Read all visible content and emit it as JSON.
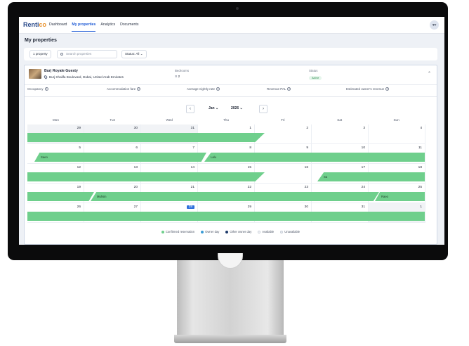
{
  "app": {
    "logo": "Renti",
    "logo_accent": "co"
  },
  "nav": {
    "items": [
      "Dashboard",
      "My properties",
      "Analytics",
      "Documents"
    ],
    "active": "My properties"
  },
  "user": {
    "initials": "TT"
  },
  "page": {
    "title": "My properties"
  },
  "toolbar": {
    "count_label": "1 property",
    "search_placeholder": "Search properties",
    "status_filter": "Status: All"
  },
  "property": {
    "name": "Burj Royale Guesty",
    "address": "Burj Khalifa Boulevard, Dubai, United Arab Emirates",
    "bedrooms_label": "Bedrooms",
    "bedrooms_value": "2",
    "status_label": "Status",
    "status_value": "Active"
  },
  "stats": {
    "occupancy": "Occupancy",
    "accommodation_fare": "Accommodation fare",
    "avg_nightly_rate": "Average nightly rate",
    "revenue_pal": "Revenue PAL",
    "owner_revenue": "Estimated owner's revenue"
  },
  "calendar": {
    "month": "Jan",
    "year": "2026",
    "day_names": [
      "Mon",
      "Tue",
      "Wed",
      "Thu",
      "Fri",
      "Sat",
      "Sun"
    ],
    "weeks": [
      [
        "29",
        "30",
        "31",
        "1",
        "2",
        "3",
        "4"
      ],
      [
        "5",
        "6",
        "7",
        "8",
        "9",
        "10",
        "11"
      ],
      [
        "12",
        "13",
        "14",
        "15",
        "16",
        "17",
        "18"
      ],
      [
        "19",
        "20",
        "21",
        "22",
        "23",
        "24",
        "25"
      ],
      [
        "26",
        "27",
        "28",
        "29",
        "30",
        "31",
        "1"
      ]
    ],
    "today": "28",
    "reservation_labels": {
      "saeo": "Saeo",
      "lalu": "Lalu",
      "sa": "Sa",
      "muhsin": "Muhsin",
      "raeo": "Raeo"
    }
  },
  "legend": {
    "confirmed": "Confirmed reservation",
    "owner_day": "Owner day",
    "other_owner_day": "Other owner day",
    "available": "Available",
    "unavailable": "Unavailable"
  },
  "colors": {
    "accent": "#1f5bd6",
    "reservation": "#6fcf8c",
    "owner_day": "#3a9bd5",
    "other_owner_day": "#1d3a6a"
  }
}
